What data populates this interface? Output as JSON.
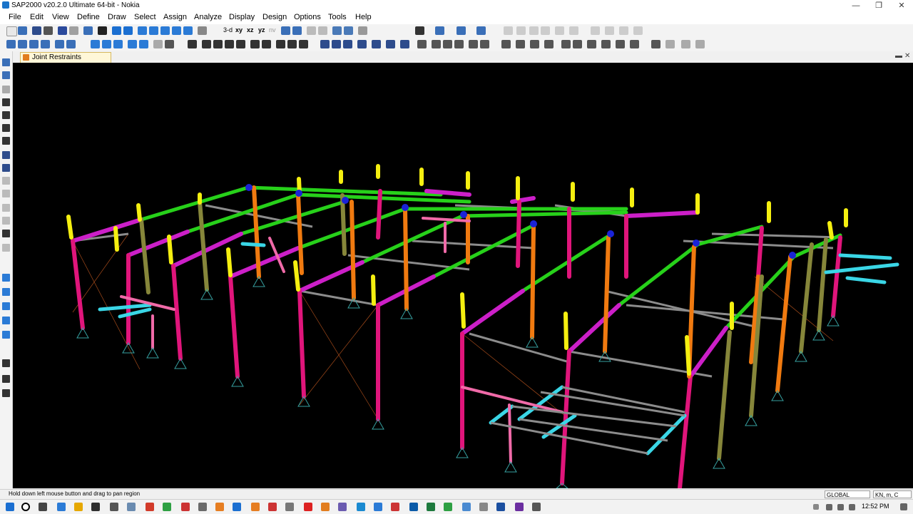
{
  "window": {
    "title": "SAP2000 v20.2.0 Ultimate 64-bit - Nokia",
    "min": "—",
    "restore": "❐",
    "close": "✕"
  },
  "menu": [
    "File",
    "Edit",
    "View",
    "Define",
    "Draw",
    "Select",
    "Assign",
    "Analyze",
    "Display",
    "Design",
    "Options",
    "Tools",
    "Help"
  ],
  "doc_tab": {
    "label": "Joint Restraints",
    "minimize": "▬",
    "close": "✕"
  },
  "toolbar_icons_row1": [
    "new-icon",
    "open-icon",
    "save-icon",
    "print-icon",
    "undo-icon",
    "redo-icon",
    "pencil-icon",
    "lock-icon",
    "run-icon",
    "run-forward-icon",
    "zoom-window-icon",
    "zoom-in-icon",
    "zoom-out-icon",
    "zoom-extents-icon",
    "pan-icon",
    "3d-view-icon",
    "xy-view-icon",
    "xz-view-icon",
    "yz-view-icon",
    "nv-view-icon",
    "rotate-icon"
  ],
  "toolbar_view_labels": {
    "three_d": "3-d",
    "xy": "xy",
    "xz": "xz",
    "yz": "yz",
    "nv": "nv"
  },
  "statusbar": {
    "hint": "Hold down left mouse button and drag to pan region",
    "coord_system": "GLOBAL",
    "units": "KN, m, C"
  },
  "taskbar": {
    "time": "12:52 PM"
  },
  "colors": {
    "canvas": "#000000",
    "column_magenta": "#e0157b",
    "beam_green": "#27d11a",
    "rafter_magenta": "#cc1fc8",
    "column_orange": "#f07a10",
    "column_olive": "#86863a",
    "cap_yellow": "#f5ef10",
    "purlin_gray": "#8c8c8c",
    "connection_blue": "#1a23d8",
    "stair_cyan": "#3ad6e6",
    "brace_pink": "#f06aa8"
  }
}
